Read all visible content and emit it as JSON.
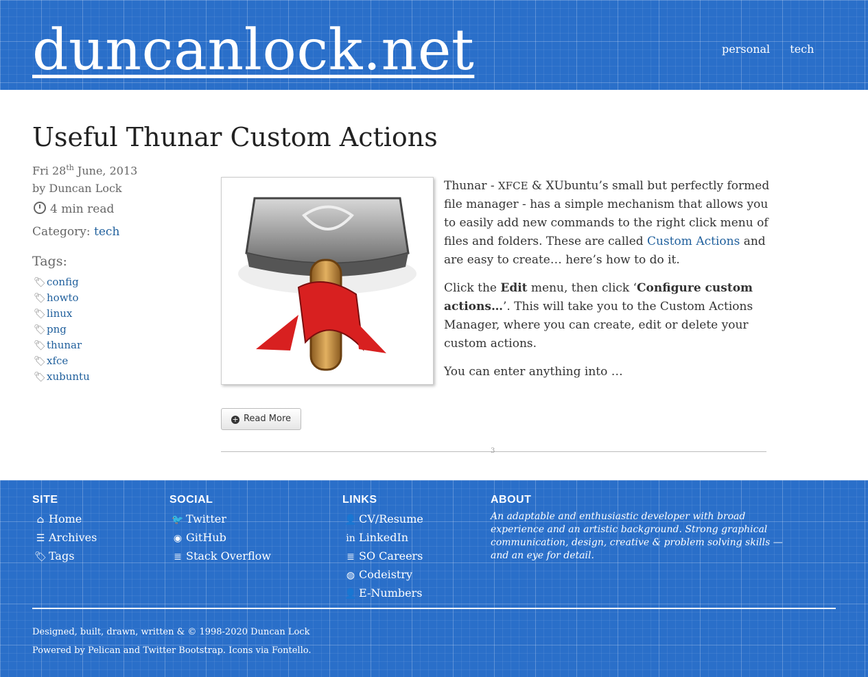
{
  "header": {
    "site_title": "duncanlock.net",
    "nav": [
      "personal",
      "tech"
    ]
  },
  "post": {
    "title": "Useful Thunar Custom Actions",
    "date_day": "Fri 28",
    "date_suffix": "th",
    "date_rest": "June, 2013",
    "author_line": "by Duncan Lock",
    "read_time": "4 min read",
    "category_label": "Category:",
    "category": "tech",
    "tags_label": "Tags:",
    "tags": [
      "config",
      "howto",
      "linux",
      "png",
      "thunar",
      "xfce",
      "xubuntu"
    ],
    "para1_a": "Thunar - ",
    "para1_xfce": "XFCE",
    "para1_b": " & XUbuntu’s small but perfectly formed file manager - has a simple mechanism that allows you to easily add new commands to the right click menu of files and folders. These are called ",
    "para1_link": "Custom Actions",
    "para1_c": " and are easy to create… here’s how to do it.",
    "para2_a": "Click the ",
    "para2_edit": "Edit",
    "para2_b": " menu, then click ‘",
    "para2_conf": "Configure custom actions…",
    "para2_c": "’. This will take you to the Custom Actions Manager, where you can create, edit or delete your custom actions.",
    "para3": "You can enter anything into …",
    "read_more": "Read More",
    "divider_mark": "3"
  },
  "footer": {
    "site_h": "SITE",
    "site_links": [
      "Home",
      "Archives",
      "Tags"
    ],
    "social_h": "SOCIAL",
    "social_links": [
      "Twitter",
      "GitHub",
      "Stack Overflow"
    ],
    "links_h": "LINKS",
    "links": [
      "CV/Resume",
      "LinkedIn",
      "SO Careers",
      "Codeistry",
      "E-Numbers"
    ],
    "about_h": "ABOUT",
    "about_text": "An adaptable and enthusiastic developer with broad experience and an artistic background. Strong graphical communication, design, creative & problem solving skills — and an eye for detail.",
    "copyright": "Designed, built, drawn, written & © 1998-2020 Duncan Lock",
    "powered_a": "Powered by ",
    "pelican": "Pelican",
    "and": " and ",
    "bootstrap": "Twitter Bootstrap",
    "icons_via": ". Icons via ",
    "fontello": "Fontello",
    "end": "."
  },
  "colors": {
    "header_bg": "#2a6fc9",
    "link": "#1f5f9c"
  }
}
